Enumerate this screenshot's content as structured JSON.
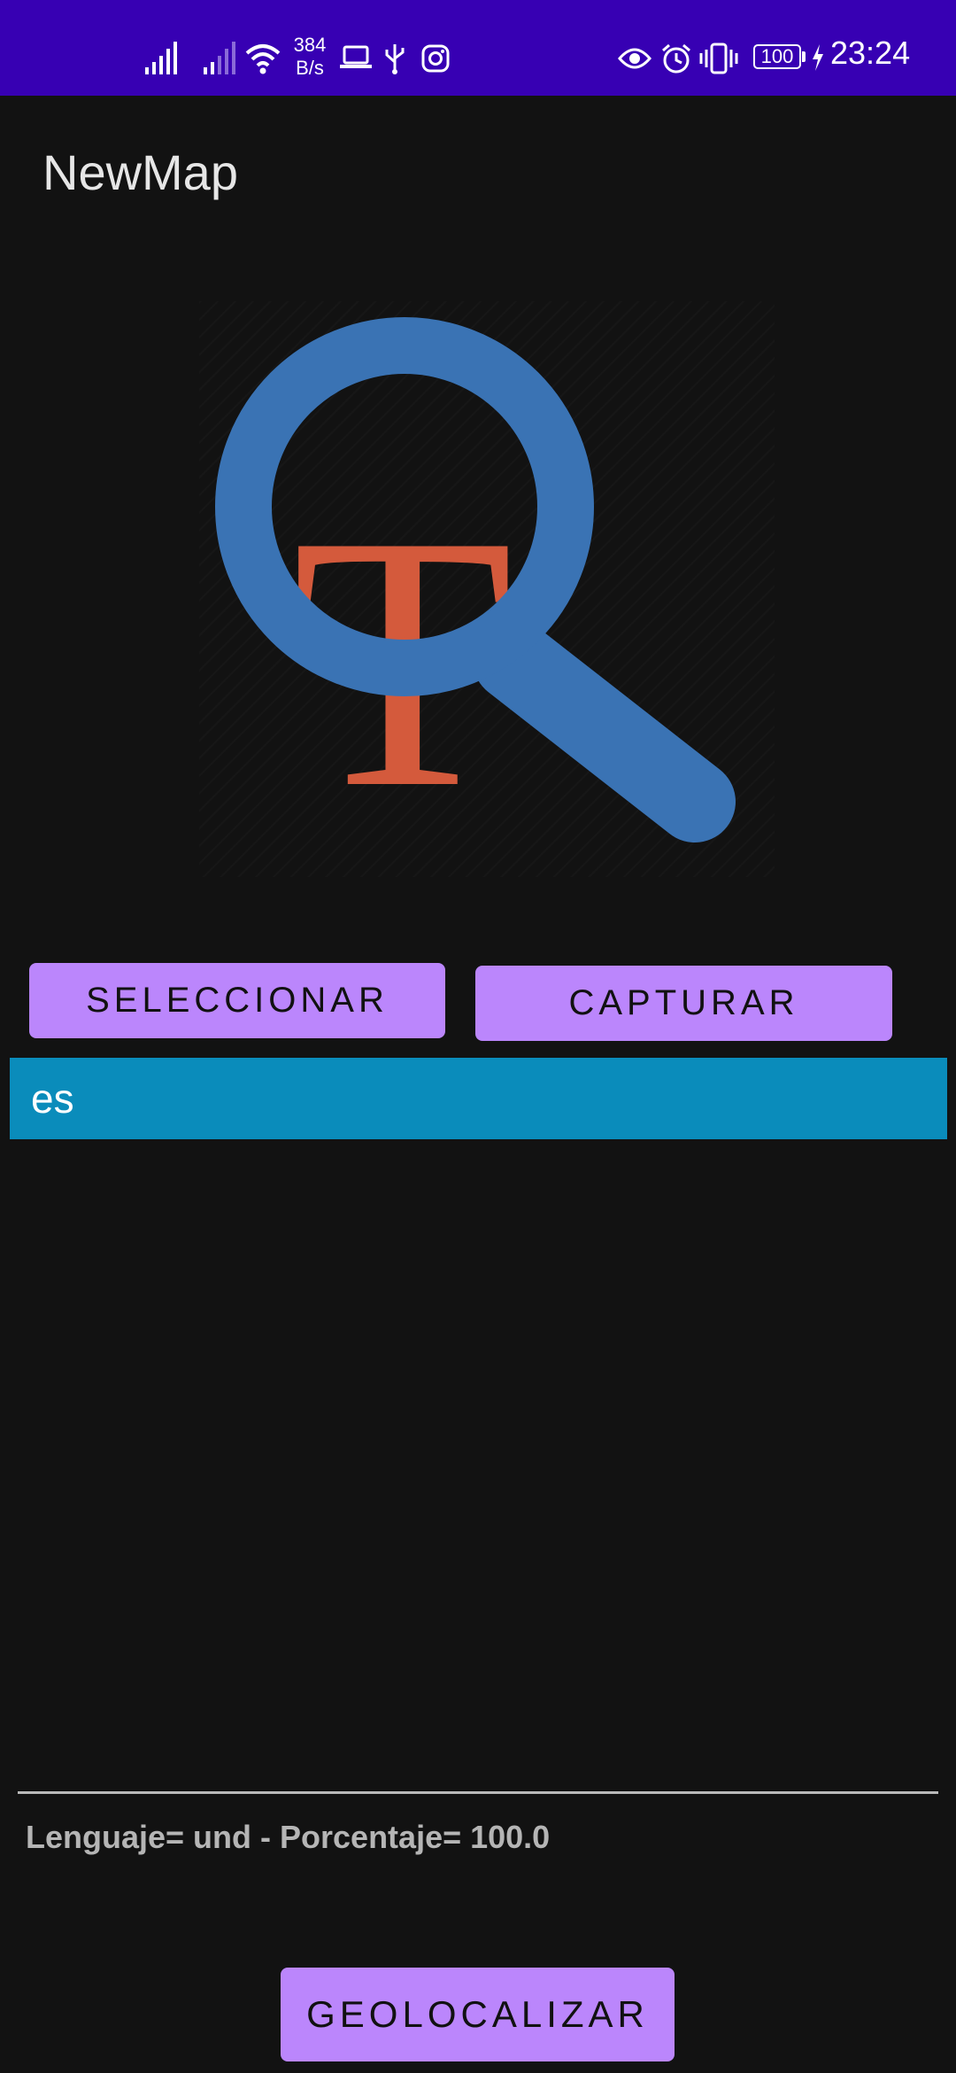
{
  "status_bar": {
    "net_speed_value": "384",
    "net_speed_unit": "B/s",
    "battery_level": "100",
    "time": "23:24",
    "icons": [
      "signal-icon",
      "signal-weak-icon",
      "wifi-icon",
      "laptop-icon",
      "usb-icon",
      "instagram-icon",
      "eye-icon",
      "alarm-icon",
      "vibrate-icon",
      "battery-icon",
      "charging-icon"
    ],
    "background_color": "#3700B3"
  },
  "app_bar": {
    "title": "NewMap"
  },
  "logo": {
    "letter": "T",
    "icon": "magnifier-icon",
    "lens_color": "#3a73b4",
    "letter_color": "#d45a3c"
  },
  "actions": {
    "select_label": "SELECCIONAR",
    "capture_label": "CAPTURAR",
    "geolocate_label": "GEOLOCALIZAR",
    "button_color": "#BB86FC"
  },
  "language_field": {
    "value": "es",
    "background_color": "#0a8cbb"
  },
  "result": {
    "text": "Lenguaje= und - Porcentaje= 100.0"
  }
}
